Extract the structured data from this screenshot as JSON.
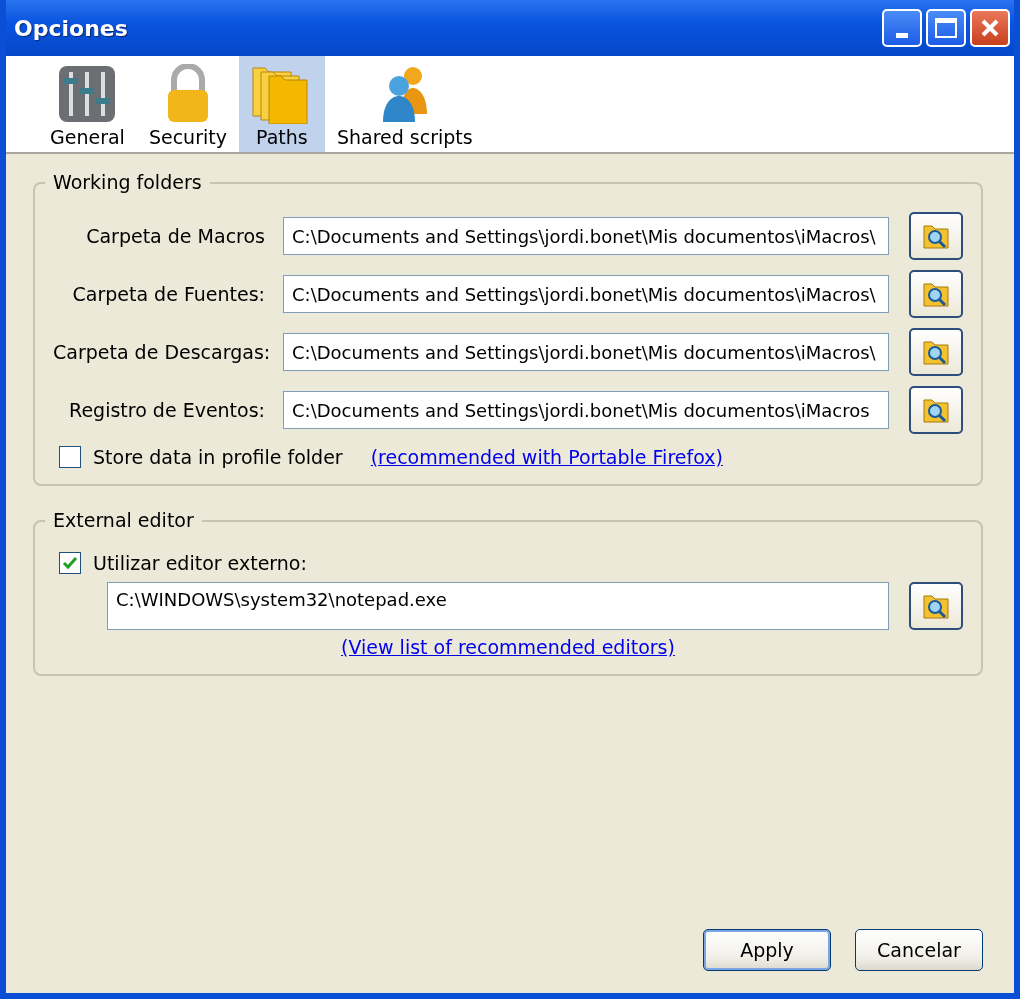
{
  "window": {
    "title": "Opciones",
    "controls": [
      {
        "kind": "minimize"
      },
      {
        "kind": "maximize"
      },
      {
        "kind": "close"
      }
    ]
  },
  "tabs": [
    {
      "label": "General",
      "kind": "sliders",
      "selected": false
    },
    {
      "label": "Security",
      "kind": "padlock",
      "selected": false
    },
    {
      "label": "Paths",
      "kind": "folders",
      "selected": true
    },
    {
      "label": "Shared scripts",
      "kind": "users",
      "selected": false
    }
  ],
  "working_folders": {
    "title": "Working folders",
    "rows": [
      {
        "label": "Carpeta de Macros",
        "value": "C:\\Documents and Settings\\jordi.bonet\\Mis documentos\\iMacros\\"
      },
      {
        "label": "Carpeta de Fuentes:",
        "value": "C:\\Documents and Settings\\jordi.bonet\\Mis documentos\\iMacros\\"
      },
      {
        "label": "Carpeta de Descargas:",
        "value": "C:\\Documents and Settings\\jordi.bonet\\Mis documentos\\iMacros\\"
      },
      {
        "label": "Registro de Eventos:",
        "value": "C:\\Documents and Settings\\jordi.bonet\\Mis documentos\\iMacros"
      }
    ],
    "store_in_profile": {
      "label": "Store data in profile folder",
      "checked": false
    },
    "link": "(recommended with Portable Firefox)"
  },
  "external_editor": {
    "title": "External editor",
    "use_external": {
      "label": "Utilizar editor externo:",
      "checked": true
    },
    "value": "C:\\WINDOWS\\system32\\notepad.exe",
    "link": "(View list of recommended editors)"
  },
  "buttons": [
    {
      "label": "Apply",
      "default": true
    },
    {
      "label": "Cancelar",
      "default": false
    }
  ]
}
